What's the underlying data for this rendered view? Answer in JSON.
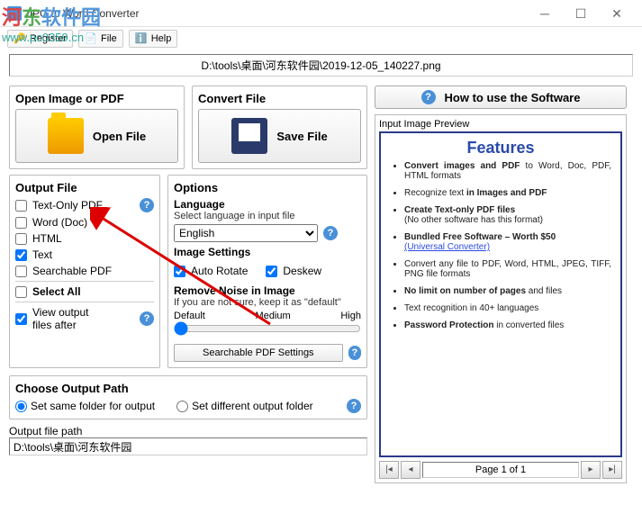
{
  "window": {
    "title": "JPG to Word Converter"
  },
  "watermark": {
    "line1": "河东软件园",
    "line2": "www.pc0359.cn"
  },
  "menu": {
    "register": "Register",
    "file": "File",
    "help": "Help"
  },
  "path": "D:\\tools\\桌面\\河东软件园\\2019-12-05_140227.png",
  "open_group": {
    "title": "Open Image or PDF",
    "btn": "Open File"
  },
  "convert_group": {
    "title": "Convert File",
    "btn": "Save File"
  },
  "output": {
    "title": "Output File",
    "items": {
      "textpdf": "Text-Only PDF",
      "word": "Word (Doc)",
      "html": "HTML",
      "text": "Text",
      "searchpdf": "Searchable PDF"
    },
    "selectall": "Select All",
    "view": "View output\nfiles after"
  },
  "options": {
    "title": "Options",
    "lang_title": "Language",
    "lang_desc": "Select language in input file",
    "lang_value": "English",
    "img_title": "Image Settings",
    "autorotate": "Auto Rotate",
    "deskew": "Deskew",
    "noise_title": "Remove Noise in Image",
    "noise_desc": "If you are not sure, keep it as \"default\"",
    "s1": "Default",
    "s2": "Medium",
    "s3": "High",
    "search_btn": "Searchable PDF Settings"
  },
  "choose": {
    "title": "Choose Output Path",
    "r1": "Set same folder for output",
    "r2": "Set different output folder"
  },
  "outpath": {
    "label": "Output file path",
    "value": "D:\\tools\\桌面\\河东软件园"
  },
  "howto": "How to use the Software",
  "preview": {
    "label": "Input Image Preview",
    "heading": "Features",
    "f1a": "Convert images and PDF",
    "f1b": " to Word, Doc, PDF, HTML formats",
    "f2a": "Recognize text ",
    "f2b": "in Images and PDF",
    "f3a": "Create Text-only PDF files",
    "f3b": "(No other software has this format)",
    "f4a": "Bundled Free Software – Worth $50",
    "f4link": "(Universal Converter)",
    "f5": "Convert any file to PDF, Word, HTML, JPEG, TIFF, PNG file formats",
    "f6a": "No limit on number of pages",
    "f6b": " and files",
    "f7": "Text recognition in 40+ languages",
    "f8a": "Password Protection",
    "f8b": " in converted files",
    "pager": "Page 1 of 1"
  }
}
